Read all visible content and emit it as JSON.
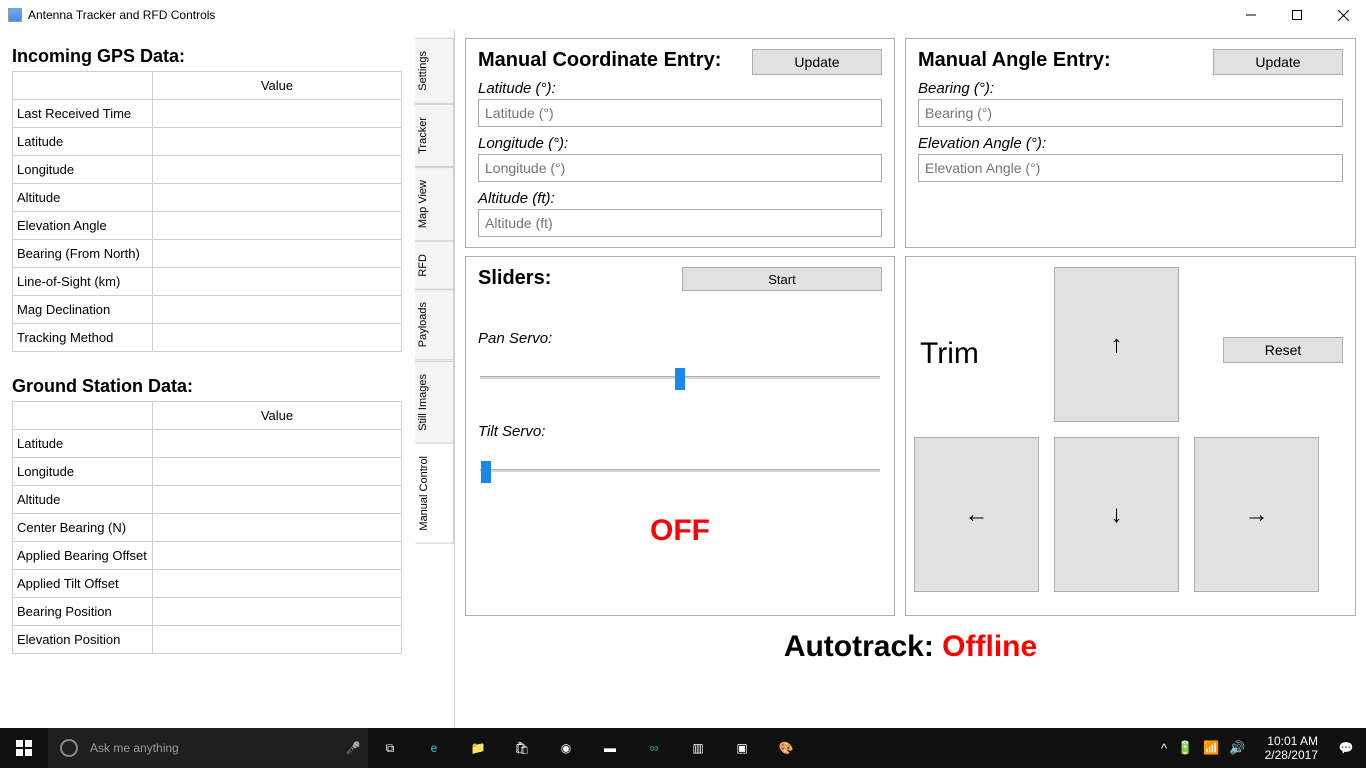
{
  "window": {
    "title": "Antenna Tracker and RFD Controls"
  },
  "left": {
    "gps_heading": "Incoming GPS Data:",
    "value_header": "Value",
    "gps_rows": [
      "Last Received Time",
      "Latitude",
      "Longitude",
      "Altitude",
      "Elevation Angle",
      "Bearing (From North)",
      "Line-of-Sight (km)",
      "Mag Declination",
      "Tracking Method"
    ],
    "ground_heading": "Ground Station Data:",
    "ground_rows": [
      "Latitude",
      "Longitude",
      "Altitude",
      "Center Bearing (N)",
      "Applied Bearing Offset",
      "Applied Tilt Offset",
      "Bearing Position",
      "Elevation Position"
    ]
  },
  "tabs": [
    "Settings",
    "Tracker",
    "Map View",
    "RFD",
    "Payloads",
    "Still Images",
    "Manual Control"
  ],
  "active_tab": "Manual Control",
  "coord": {
    "heading": "Manual Coordinate Entry:",
    "update": "Update",
    "lat_label": "Latitude (°):",
    "lat_ph": "Latitude (°)",
    "lon_label": "Longitude (°):",
    "lon_ph": "Longitude (°)",
    "alt_label": "Altitude (ft):",
    "alt_ph": "Altitude (ft)"
  },
  "angle": {
    "heading": "Manual Angle Entry:",
    "update": "Update",
    "bearing_label": "Bearing (°):",
    "bearing_ph": "Bearing (°)",
    "elev_label": "Elevation Angle (°):",
    "elev_ph": "Elevation Angle (°)"
  },
  "sliders": {
    "heading": "Sliders:",
    "start": "Start",
    "pan_label": "Pan Servo:",
    "tilt_label": "Tilt Servo:",
    "pan_pos_pct": 50,
    "tilt_pos_pct": 2,
    "status": "OFF"
  },
  "trim": {
    "heading": "Trim",
    "reset": "Reset",
    "up": "↑",
    "down": "↓",
    "left": "←",
    "right": "→"
  },
  "autotrack": {
    "label": "Autotrack: ",
    "status": "Offline"
  },
  "taskbar": {
    "search_ph": "Ask me anything",
    "time": "10:01 AM",
    "date": "2/28/2017"
  }
}
